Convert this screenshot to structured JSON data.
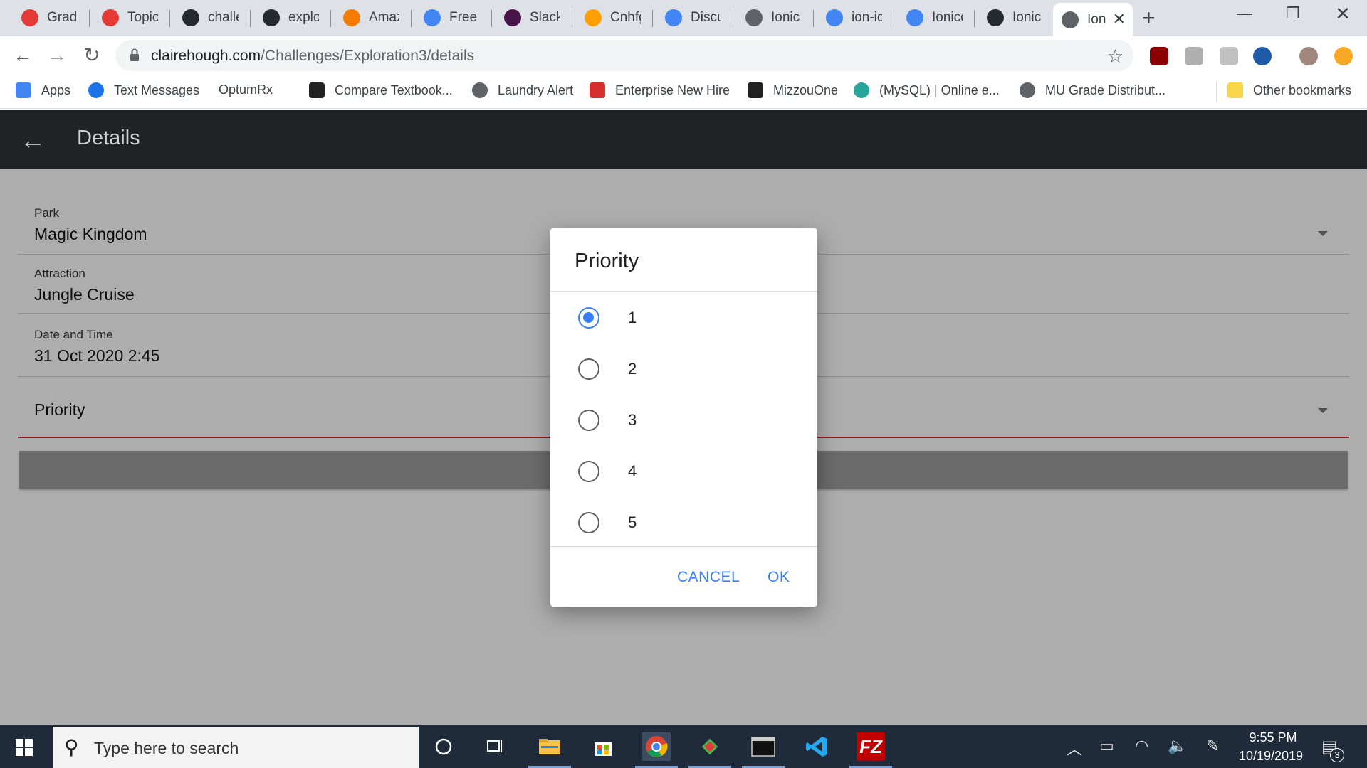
{
  "browser": {
    "tabs": [
      {
        "title": "Grade",
        "icon": "red-gear-icon",
        "color": "#e53935"
      },
      {
        "title": "Topic:",
        "icon": "red-gear-icon",
        "color": "#e53935"
      },
      {
        "title": "challe",
        "icon": "github-icon",
        "color": "#24292e"
      },
      {
        "title": "explor",
        "icon": "github-icon",
        "color": "#24292e"
      },
      {
        "title": "Amazo",
        "icon": "amazon-box-icon",
        "color": "#f57c00"
      },
      {
        "title": "Free M",
        "icon": "chrome-blue-icon",
        "color": "#4285f4"
      },
      {
        "title": "Slack |",
        "icon": "slack-icon",
        "color": "#4a154b"
      },
      {
        "title": "Cnhfg",
        "icon": "firebase-icon",
        "color": "#ffa000"
      },
      {
        "title": "Discus",
        "icon": "docs-icon",
        "color": "#4285f4"
      },
      {
        "title": "Ionic A",
        "icon": "globe-icon",
        "color": "#5f6368"
      },
      {
        "title": "ion-ico",
        "icon": "google-icon",
        "color": "#4285f4"
      },
      {
        "title": "Ionico",
        "icon": "chrome-blue-icon",
        "color": "#4285f4"
      },
      {
        "title": "Ionic I",
        "icon": "github-icon",
        "color": "#24292e"
      },
      {
        "title": "Ion",
        "icon": "globe-icon",
        "color": "#5f6368"
      }
    ],
    "url_host": "clairehough.com",
    "url_path": "/Challenges/Exploration3/details",
    "bookmarks": [
      {
        "label": "Apps",
        "color": "#4285f4"
      },
      {
        "label": "Text Messages",
        "color": "#1a73e8"
      },
      {
        "label": "OptumRx",
        "color": "#ffffff"
      },
      {
        "label": "Compare Textbook...",
        "color": "#222222"
      },
      {
        "label": "Laundry Alert",
        "color": "#5f6368"
      },
      {
        "label": "Enterprise New Hire",
        "color": "#d32f2f"
      },
      {
        "label": "MizzouOne",
        "color": "#222222"
      },
      {
        "label": "(MySQL) | Online e...",
        "color": "#26a69a"
      },
      {
        "label": "MU Grade Distribut...",
        "color": "#5f6368"
      },
      {
        "label": "Other bookmarks",
        "color": "#f9d649"
      }
    ]
  },
  "app": {
    "title": "Details",
    "fields": [
      {
        "label": "Park",
        "value": "Magic Kingdom"
      },
      {
        "label": "Attraction",
        "value": "Jungle Cruise"
      },
      {
        "label": "Date and Time",
        "value": "31 Oct 2020 2:45"
      }
    ],
    "priority_placeholder": "Priority"
  },
  "dialog": {
    "title": "Priority",
    "options": [
      "1",
      "2",
      "3",
      "4",
      "5"
    ],
    "selected": "1",
    "cancel_label": "CANCEL",
    "ok_label": "OK",
    "accent": "#3880ff"
  },
  "taskbar": {
    "search_placeholder": "Type here to search",
    "time": "9:55 PM",
    "date": "10/19/2019",
    "notification_count": "3"
  }
}
